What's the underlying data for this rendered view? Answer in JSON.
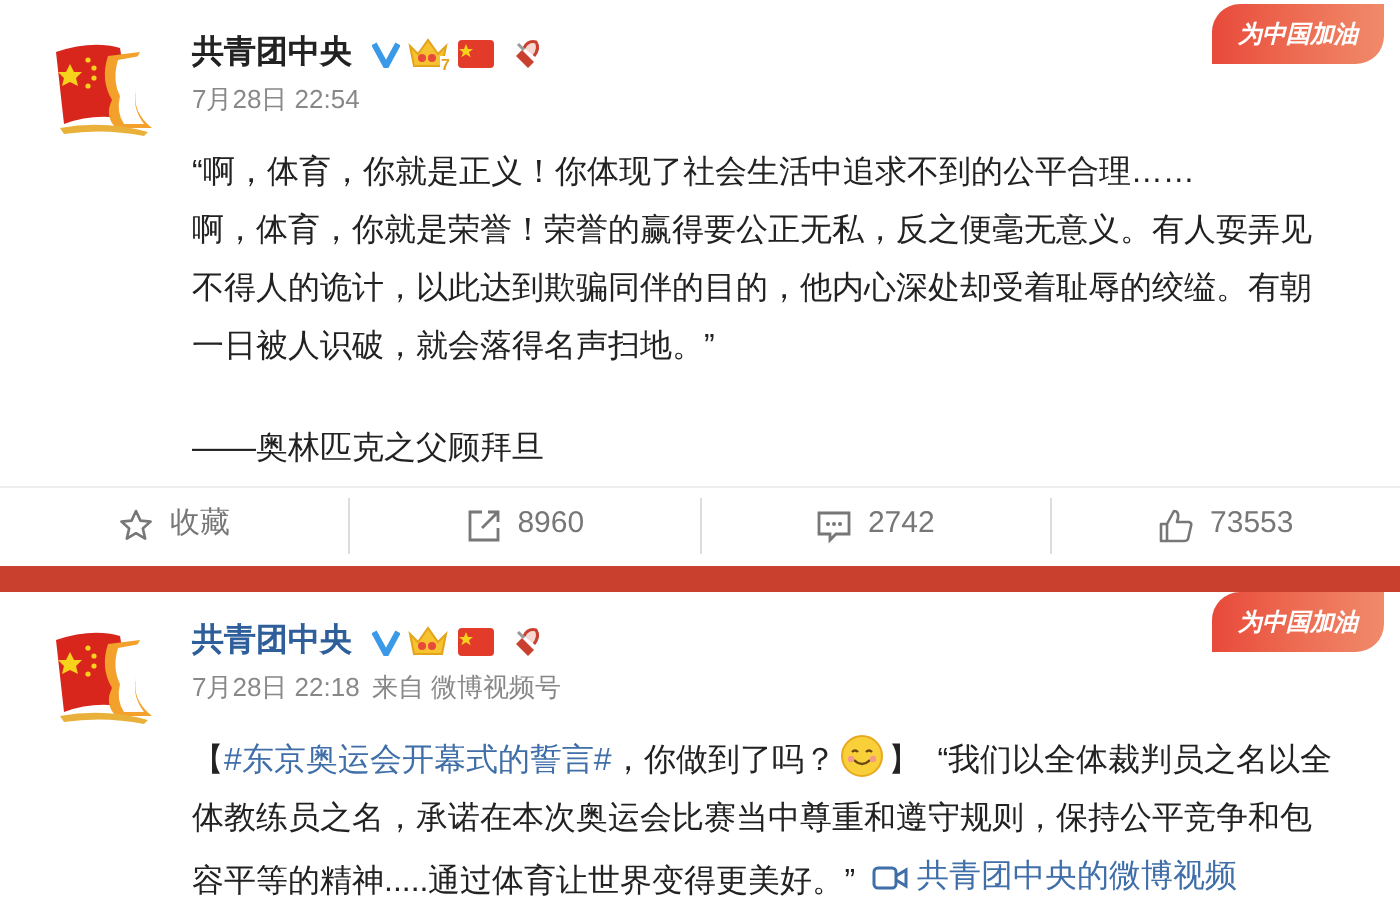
{
  "posts": [
    {
      "author": "共青团中央",
      "author_link": false,
      "crown_level": "7",
      "time": "7月28日 22:54",
      "banner": "为中国加油",
      "paragraphs": [
        {
          "kind": "text",
          "text": "“啊，体育，你就是正义！你体现了社会生活中追求不到的公平合理……"
        },
        {
          "kind": "text",
          "text": "啊，体育，你就是荣誉！荣誉的赢得要公正无私，反之便毫无意义。有人耍弄见不得人的诡计，以此达到欺骗同伴的目的，他内心深处却受着耻辱的绞缢。有朝一日被人识破，就会落得名声扫地。”"
        },
        {
          "kind": "gap"
        },
        {
          "kind": "text",
          "text": "——奥林匹克之父顾拜旦"
        }
      ],
      "actions": [
        {
          "kind": "favorite",
          "label": "收藏"
        },
        {
          "kind": "share",
          "label": "8960"
        },
        {
          "kind": "comment",
          "label": "2742"
        },
        {
          "kind": "like",
          "label": "73553"
        }
      ]
    },
    {
      "author": "共青团中央",
      "author_link": true,
      "time": "7月28日 22:18",
      "source": "来自 微博视频号",
      "banner": "为中国加油",
      "paragraphs": [
        {
          "kind": "rich",
          "parts": [
            {
              "kind": "text",
              "text": "【"
            },
            {
              "kind": "hashtag",
              "text": "#东京奥运会开幕式的誓言#"
            },
            {
              "kind": "text",
              "text": "，你做到了吗？"
            },
            {
              "kind": "emoji"
            },
            {
              "kind": "text",
              "text": "】  “我们以全体裁判员之名以全体教练员之名，承诺在本次奥运会比赛当中尊重和遵守规则，保持公平竞争和包容平等的精神.....通过体育让世界变得更美好。”  "
            },
            {
              "kind": "video",
              "text": "共青团中央的微博视频"
            }
          ]
        }
      ]
    }
  ]
}
